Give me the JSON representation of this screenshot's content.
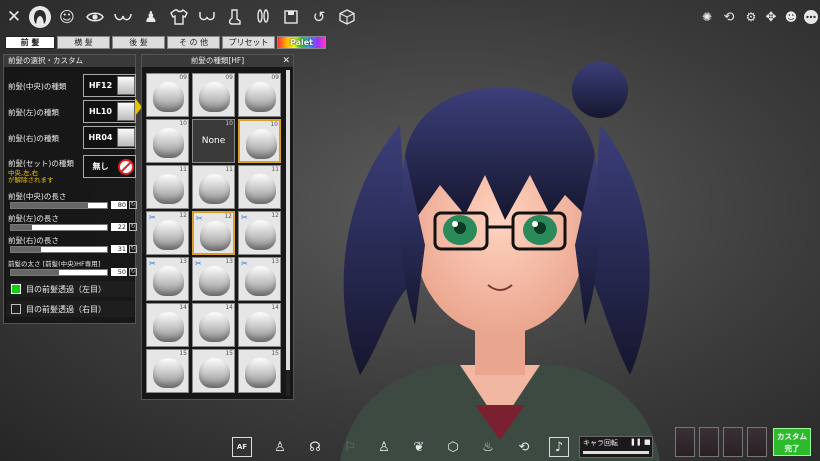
{
  "top_icons": [
    "close-icon",
    "hair-icon",
    "face-icon",
    "eye-icon",
    "chest-icon",
    "body-icon",
    "shirt-icon",
    "bra-icon",
    "sock-icon",
    "bunny-ears-icon",
    "save-icon",
    "undo-icon",
    "dice-icon"
  ],
  "top_right_icons": [
    "lights-icon",
    "camera-rotate-icon",
    "gear-pair-icon",
    "move-icon",
    "rabbit-icon",
    "menu-icon"
  ],
  "tabs": [
    {
      "label": "前 髪",
      "selected": true
    },
    {
      "label": "横 髪",
      "selected": false
    },
    {
      "label": "後 髪",
      "selected": false
    },
    {
      "label": "そ の 他",
      "selected": false
    },
    {
      "label": "プリセット",
      "selected": false
    },
    {
      "label": "Palet",
      "selected": false
    }
  ],
  "left_panel": {
    "title": "前髪の選択・カスタム",
    "slots": [
      {
        "label": "前髪(中央)の種類",
        "code": "HF12"
      },
      {
        "label": "前髪(左)の種類",
        "code": "HL10"
      },
      {
        "label": "前髪(右)の種類",
        "code": "HR04"
      }
    ],
    "set": {
      "label": "前髪(セット)の種類",
      "note1": "中央,左,右",
      "note2": "が解除されます",
      "value": "無し"
    },
    "sliders": [
      {
        "label": "前髪(中央)の長さ",
        "value": "80",
        "fraction": 0.8
      },
      {
        "label": "前髪(左)の長さ",
        "value": "22",
        "fraction": 0.22
      },
      {
        "label": "前髪(右)の長さ",
        "value": "31",
        "fraction": 0.31
      },
      {
        "label": "前髪の太さ [前髪(中央)HF専用]",
        "value": "50",
        "fraction": 0.5
      }
    ],
    "checks": [
      {
        "label": "目の前髪透過（左目）",
        "checked": true
      },
      {
        "label": "目の前髪透過（右目）",
        "checked": false
      }
    ]
  },
  "grid_panel": {
    "title": "前髪の種類[HF]",
    "none_label": "None",
    "cells": [
      {
        "num": "09",
        "none": false,
        "sel": false,
        "scissors": false
      },
      {
        "num": "09",
        "none": false,
        "sel": false,
        "scissors": false
      },
      {
        "num": "09",
        "none": false,
        "sel": false,
        "scissors": false
      },
      {
        "num": "10",
        "none": false,
        "sel": false,
        "scissors": false
      },
      {
        "num": "10",
        "none": true,
        "sel": false,
        "scissors": false
      },
      {
        "num": "10",
        "none": false,
        "sel": true,
        "scissors": false
      },
      {
        "num": "11",
        "none": false,
        "sel": false,
        "scissors": false
      },
      {
        "num": "11",
        "none": false,
        "sel": false,
        "scissors": false
      },
      {
        "num": "11",
        "none": false,
        "sel": false,
        "scissors": false
      },
      {
        "num": "12",
        "none": false,
        "sel": false,
        "scissors": true
      },
      {
        "num": "12",
        "none": false,
        "sel": true,
        "scissors": true
      },
      {
        "num": "12",
        "none": false,
        "sel": false,
        "scissors": true
      },
      {
        "num": "13",
        "none": false,
        "sel": false,
        "scissors": true
      },
      {
        "num": "13",
        "none": false,
        "sel": false,
        "scissors": true
      },
      {
        "num": "13",
        "none": false,
        "sel": false,
        "scissors": true
      },
      {
        "num": "14",
        "none": false,
        "sel": false,
        "scissors": false
      },
      {
        "num": "14",
        "none": false,
        "sel": false,
        "scissors": false
      },
      {
        "num": "14",
        "none": false,
        "sel": false,
        "scissors": false
      },
      {
        "num": "15",
        "none": false,
        "sel": false,
        "scissors": false
      },
      {
        "num": "15",
        "none": false,
        "sel": false,
        "scissors": false
      },
      {
        "num": "15",
        "none": false,
        "sel": false,
        "scissors": false
      }
    ]
  },
  "bottom": {
    "af_label": "AF",
    "music_label": "キャラ回転",
    "finish_label_1": "カスタム",
    "finish_label_2": "完了"
  },
  "colors": {
    "accent_green": "#2dbb2d",
    "selection_gold": "#d9a030",
    "hair": "#1c1d3d"
  }
}
